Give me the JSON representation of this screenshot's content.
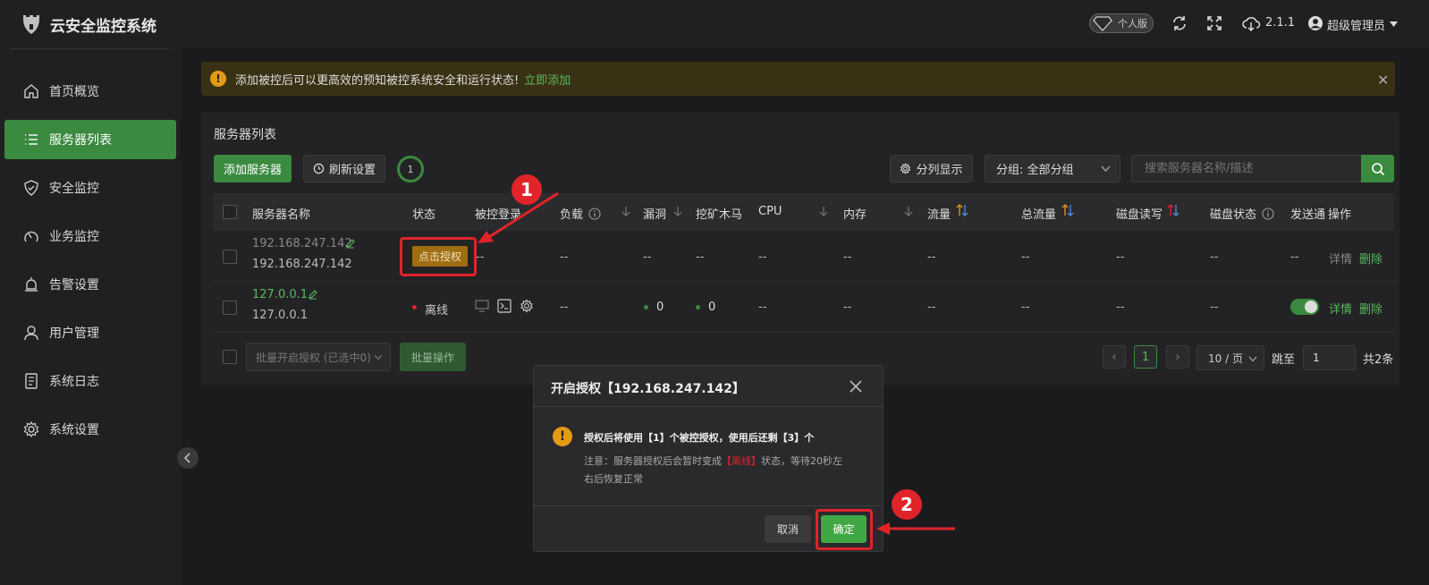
{
  "app": {
    "title": "云安全监控系统"
  },
  "sidebar": {
    "items": [
      {
        "label": "首页概览",
        "icon": "home-icon"
      },
      {
        "label": "服务器列表",
        "icon": "list-icon",
        "active": true
      },
      {
        "label": "安全监控",
        "icon": "shield-icon"
      },
      {
        "label": "业务监控",
        "icon": "gauge-icon"
      },
      {
        "label": "告警设置",
        "icon": "alarm-icon"
      },
      {
        "label": "用户管理",
        "icon": "user-icon"
      },
      {
        "label": "系统日志",
        "icon": "log-icon"
      },
      {
        "label": "系统设置",
        "icon": "gear-icon"
      }
    ]
  },
  "topbar": {
    "edition": "个人版",
    "version": "2.1.1",
    "user": "超级管理员"
  },
  "alert": {
    "text": "添加被控后可以更高效的预知被控系统安全和运行状态!",
    "link": "立即添加"
  },
  "panel": {
    "title": "服务器列表",
    "add_button": "添加服务器",
    "refresh_button": "刷新设置",
    "refresh_count": "1",
    "columns_button": "分列显示",
    "group_select": "分组: 全部分组",
    "search_placeholder": "搜索服务器名称/描述"
  },
  "table": {
    "headers": {
      "name": "服务器名称",
      "status": "状态",
      "login": "被控登录",
      "load": "负载",
      "vuln": "漏洞",
      "miner": "挖矿木马",
      "cpu": "CPU",
      "mem": "内存",
      "traffic": "流量",
      "total_traffic": "总流量",
      "disk_io": "磁盘读写",
      "disk_status": "磁盘状态",
      "send": "发送通",
      "ops": "操作"
    },
    "rows": [
      {
        "name": "192.168.247.142",
        "ip": "192.168.247.142",
        "auth_button": "点击授权",
        "login": "--",
        "load": "--",
        "vuln": "--",
        "miner": "--",
        "cpu": "--",
        "mem": "--",
        "traffic": "--",
        "total_traffic": "--",
        "disk_io": "--",
        "disk_status": "--",
        "send": "--",
        "detail": "详情",
        "delete": "删除"
      },
      {
        "name": "127.0.0.1",
        "ip": "127.0.0.1",
        "status": "离线",
        "load": "--",
        "vuln": "0",
        "miner": "0",
        "cpu": "--",
        "mem": "--",
        "traffic": "--",
        "total_traffic": "--",
        "disk_io": "--",
        "disk_status": "--",
        "detail": "详情",
        "delete": "删除"
      }
    ]
  },
  "footer": {
    "batch_select": "批量开启授权 (已选中0)",
    "batch_button": "批量操作",
    "page": "1",
    "page_size": "10 / 页",
    "goto_label": "跳至",
    "goto_value": "1",
    "total": "共2条"
  },
  "modal": {
    "title": "开启授权【192.168.247.142】",
    "message": "授权后将使用【1】个被控授权，使用后还剩【3】个",
    "note_prefix": "注意：服务器授权后会暂时变成",
    "note_status": "【离线】",
    "note_suffix_1": "状态，等待20秒左",
    "note_suffix_2": "右后恢复正常",
    "cancel": "取消",
    "confirm": "确定"
  },
  "annotations": {
    "step1": "1",
    "step2": "2"
  },
  "colors": {
    "accent": "#3a8a3f",
    "warning": "#e39a16",
    "danger": "#e0242a"
  }
}
